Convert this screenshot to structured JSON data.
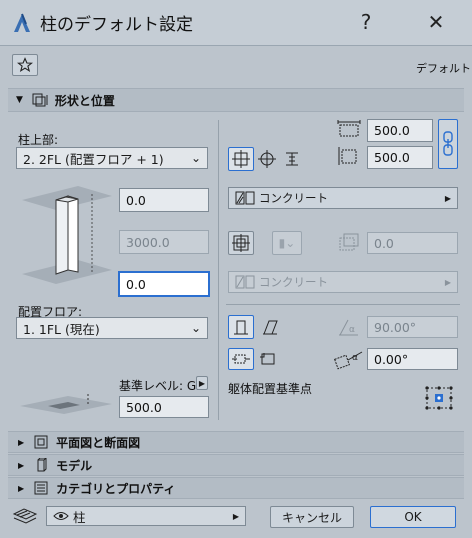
{
  "window": {
    "title": "柱のデフォルト設定",
    "help_glyph": "?",
    "close_glyph": "✕"
  },
  "toolbar": {
    "favorites_icon": "star-icon",
    "default_label": "デフォルト"
  },
  "sections": {
    "shape_position": "形状と位置",
    "plan_section": "平面図と断面図",
    "model": "モデル",
    "category_props": "カテゴリとプロパティ"
  },
  "geometry": {
    "top_link_label": "柱上部:",
    "top_link_value": "2. 2FL (配置フロア + 1)",
    "top_offset": "0.0",
    "height": "3000.0",
    "bottom_offset": "0.0",
    "home_story_label": "配置フロア:",
    "home_story_value": "1. 1FL (現在)",
    "ref_level_label": "基準レベル: GL",
    "ref_level_value": "500.0"
  },
  "size": {
    "width": "500.0",
    "depth": "500.0"
  },
  "core": {
    "material": "コンクリート"
  },
  "veneer": {
    "thickness": "0.0",
    "material": "コンクリート"
  },
  "angle": {
    "slant_angle": "90.00°",
    "rotation_angle": "0.00°",
    "anchor_label": "躯体配置基準点"
  },
  "footer": {
    "layer": "柱",
    "cancel": "キャンセル",
    "ok": "OK"
  },
  "colors": {
    "accent": "#2b6fd0",
    "background": "#bcc4cc"
  }
}
